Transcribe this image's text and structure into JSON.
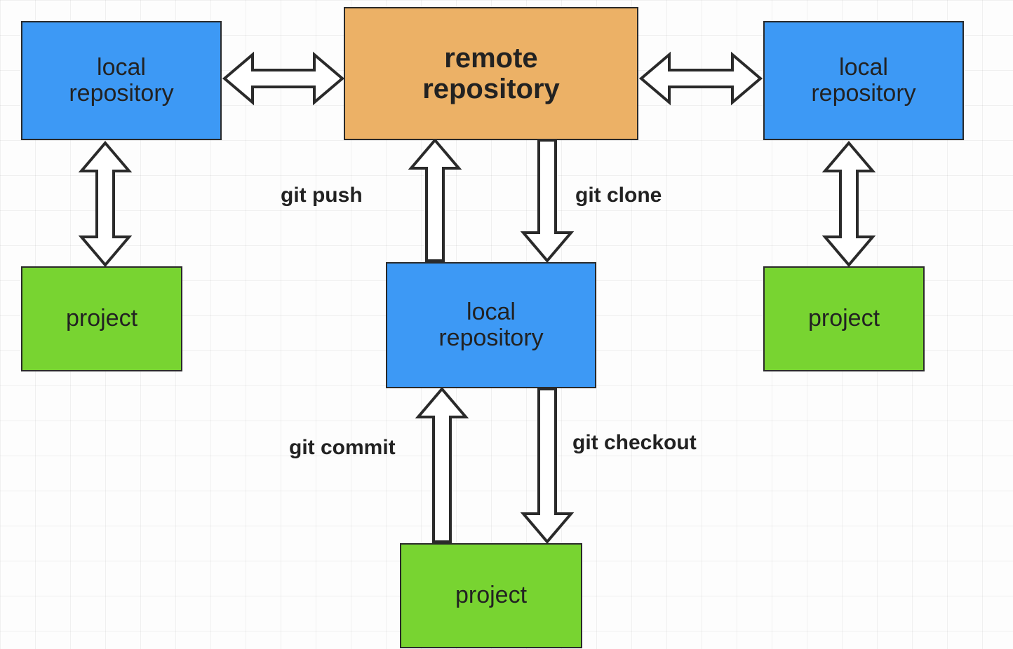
{
  "colors": {
    "blue": "#3d99f5",
    "orange": "#ecb166",
    "green": "#78d431",
    "stroke": "#2a2a2a"
  },
  "nodes": {
    "remote": {
      "label": "remote\nrepository"
    },
    "local_left": {
      "label": "local\nrepository"
    },
    "local_right": {
      "label": "local\nrepository"
    },
    "local_center": {
      "label": "local\nrepository"
    },
    "project_left": {
      "label": "project"
    },
    "project_right": {
      "label": "project"
    },
    "project_center": {
      "label": "project"
    }
  },
  "labels": {
    "push": "git push",
    "clone": "git clone",
    "commit": "git commit",
    "checkout": "git checkout"
  }
}
